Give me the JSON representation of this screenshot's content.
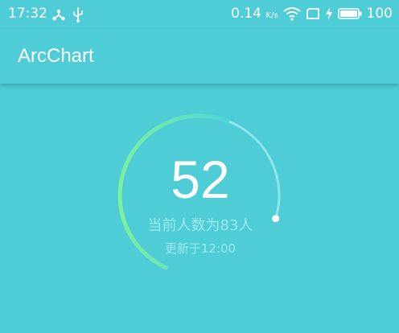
{
  "status_bar": {
    "time": "17:32",
    "network_speed": "0.14",
    "network_unit": "K/s",
    "battery_level": "100",
    "icons": [
      "share-icon",
      "usb-icon",
      "wifi-icon",
      "sim-icon",
      "charging-icon",
      "battery-icon"
    ]
  },
  "app_bar": {
    "title": "ArcChart"
  },
  "gauge": {
    "value": "52",
    "people_text": "当前人数为83人",
    "update_text": "更新于12:00",
    "progress_fraction": 0.52,
    "colors": {
      "track": "#8ee5ea",
      "gradient_start": "#7df19c",
      "gradient_end": "#4fd6d6",
      "knob": "#ffffff",
      "label": "#9de9ec"
    }
  }
}
